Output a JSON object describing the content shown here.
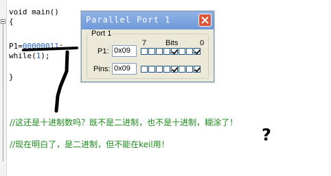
{
  "editor": {
    "lines": {
      "l1": "void main()",
      "l2": "{",
      "l3_prefix": "P1=",
      "l3_value": "00000011",
      "l3_suffix": ";",
      "l4_prefix": "while(",
      "l4_value": "1",
      "l4_suffix": ");",
      "l5": "}"
    },
    "comments": {
      "c1": "//这还是十进制数吗？既不是二进制，也不是十进制，糊涂了！",
      "c2": "//现在明白了，是二进制，但不能在keil用！"
    },
    "annotation_mark": "?"
  },
  "dialog": {
    "title": "Parallel Port 1",
    "group_label": "Port 1",
    "bits_label": "Bits",
    "bit_high": "7",
    "bit_low": "0",
    "p1_label": "P1:",
    "p1_value": "0x09",
    "pins_label": "Pins:",
    "pins_value": "0x09",
    "p1_bits": [
      false,
      false,
      false,
      false,
      true,
      false,
      false,
      true
    ],
    "pins_bits": [
      false,
      false,
      false,
      false,
      true,
      false,
      false,
      true
    ]
  },
  "colors": {
    "comment": "#1a8a1a",
    "number": "#2060c0",
    "titlebar": "#7aa2dc",
    "close": "#d9563b"
  }
}
